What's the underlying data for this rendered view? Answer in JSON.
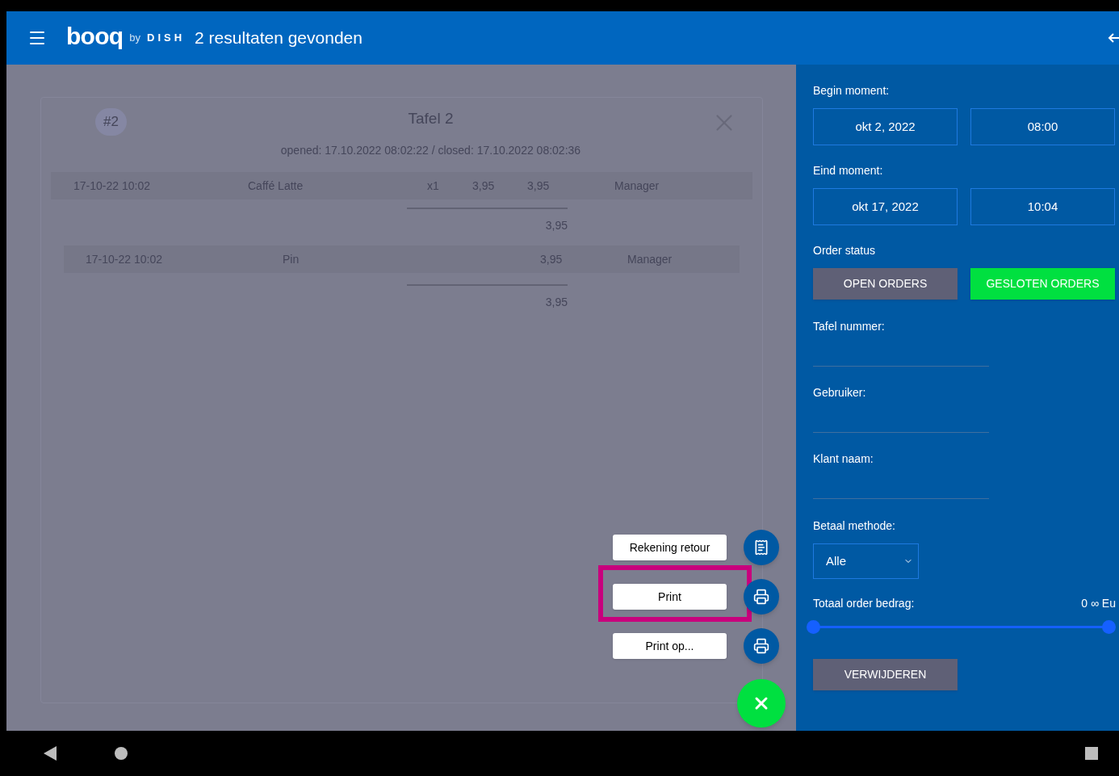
{
  "header": {
    "logo": "booq",
    "logo_suffix": "by",
    "logo_brand": "DISH",
    "title": "2 resultaten gevonden"
  },
  "order_card": {
    "badge": "#2",
    "title": "Tafel 2",
    "subtitle": "opened: 17.10.2022 08:02:22 / closed: 17.10.2022 08:02:36",
    "items": [
      {
        "time": "17-10-22 10:02",
        "name": "Caffé Latte",
        "qty": "x1",
        "price": "3,95",
        "total": "3,95",
        "user": "Manager"
      }
    ],
    "items_subtotal": "3,95",
    "payments": [
      {
        "time": "17-10-22 10:02",
        "method": "Pin",
        "amount": "3,95",
        "user": "Manager"
      }
    ],
    "payments_subtotal": "3,95"
  },
  "actions": [
    {
      "label": "Rekening retour",
      "kind": "receipt",
      "highlighted": false
    },
    {
      "label": "Print",
      "kind": "print",
      "highlighted": true
    },
    {
      "label": "Print op...",
      "kind": "print",
      "highlighted": false
    }
  ],
  "filters": {
    "begin_label": "Begin moment:",
    "begin_date": "okt 2, 2022",
    "begin_time": "08:00",
    "end_label": "Eind moment:",
    "end_date": "okt 17, 2022",
    "end_time": "10:04",
    "status_label": "Order status",
    "status_options": [
      {
        "label": "OPEN ORDERS",
        "selected": false
      },
      {
        "label": "GESLOTEN ORDERS",
        "selected": true
      }
    ],
    "text_fields": [
      {
        "label": "Tafel nummer:"
      },
      {
        "label": "Gebruiker:"
      },
      {
        "label": "Klant naam:"
      }
    ],
    "payment_label": "Betaal methode:",
    "payment_value": "Alle",
    "amount_label": "Totaal order bedrag:",
    "amount_reading": "0 ∞ Eu",
    "amount_thumbs": [
      {
        "level": 0
      },
      {
        "level": 1
      }
    ],
    "delete_button": "VERWIJDEREN"
  }
}
